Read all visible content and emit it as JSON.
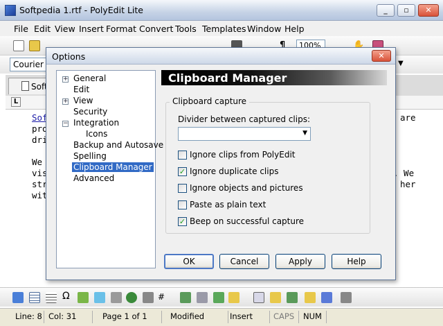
{
  "window": {
    "title": "Softpedia 1.rtf - PolyEdit Lite"
  },
  "menu": [
    "File",
    "Edit",
    "View",
    "Insert",
    "Format",
    "Convert",
    "Tools",
    "Templates",
    "Window",
    "Help"
  ],
  "toolbar": {
    "zoom": "100%"
  },
  "fontbar": {
    "font": "Courier N"
  },
  "document": {
    "tab_label": "Softp",
    "lines": [
      "Soft",
      "pro",
      "dri",
      "",
      "We",
      "vis",
      "str",
      "wit"
    ],
    "right_fragments": [
      "are",
      "",
      "",
      "",
      "",
      ". We",
      "her"
    ]
  },
  "dialog": {
    "title": "Options",
    "tree": [
      {
        "label": "General",
        "expandable": true
      },
      {
        "label": "Edit"
      },
      {
        "label": "View",
        "expandable": true
      },
      {
        "label": "Security"
      },
      {
        "label": "Integration",
        "expandable": true,
        "expanded": true
      },
      {
        "label": "Icons",
        "child": true
      },
      {
        "label": "Backup and Autosave"
      },
      {
        "label": "Spelling"
      },
      {
        "label": "Clipboard Manager",
        "selected": true
      },
      {
        "label": "Advanced"
      }
    ],
    "panel_title": "Clipboard Manager",
    "group_title": "Clipboard capture",
    "divider_label": "Divider between captured clips:",
    "divider_value": "",
    "options": [
      {
        "label": "Ignore clips from PolyEdit",
        "checked": false
      },
      {
        "label": "Ignore duplicate clips",
        "checked": true
      },
      {
        "label": "Ignore objects and pictures",
        "checked": false
      },
      {
        "label": "Paste as plain text",
        "checked": false
      },
      {
        "label": "Beep on successful capture",
        "checked": true
      }
    ],
    "buttons": {
      "ok": "OK",
      "cancel": "Cancel",
      "apply": "Apply",
      "help": "Help"
    }
  },
  "status": {
    "line": "Line:  8",
    "col": "Col:  31",
    "page": "Page 1 of 1",
    "modified": "Modified",
    "insert": "Insert",
    "caps": "CAPS",
    "num": "NUM"
  },
  "colors": {
    "selection": "#316ac5",
    "link_text": "#1a1aa6"
  }
}
